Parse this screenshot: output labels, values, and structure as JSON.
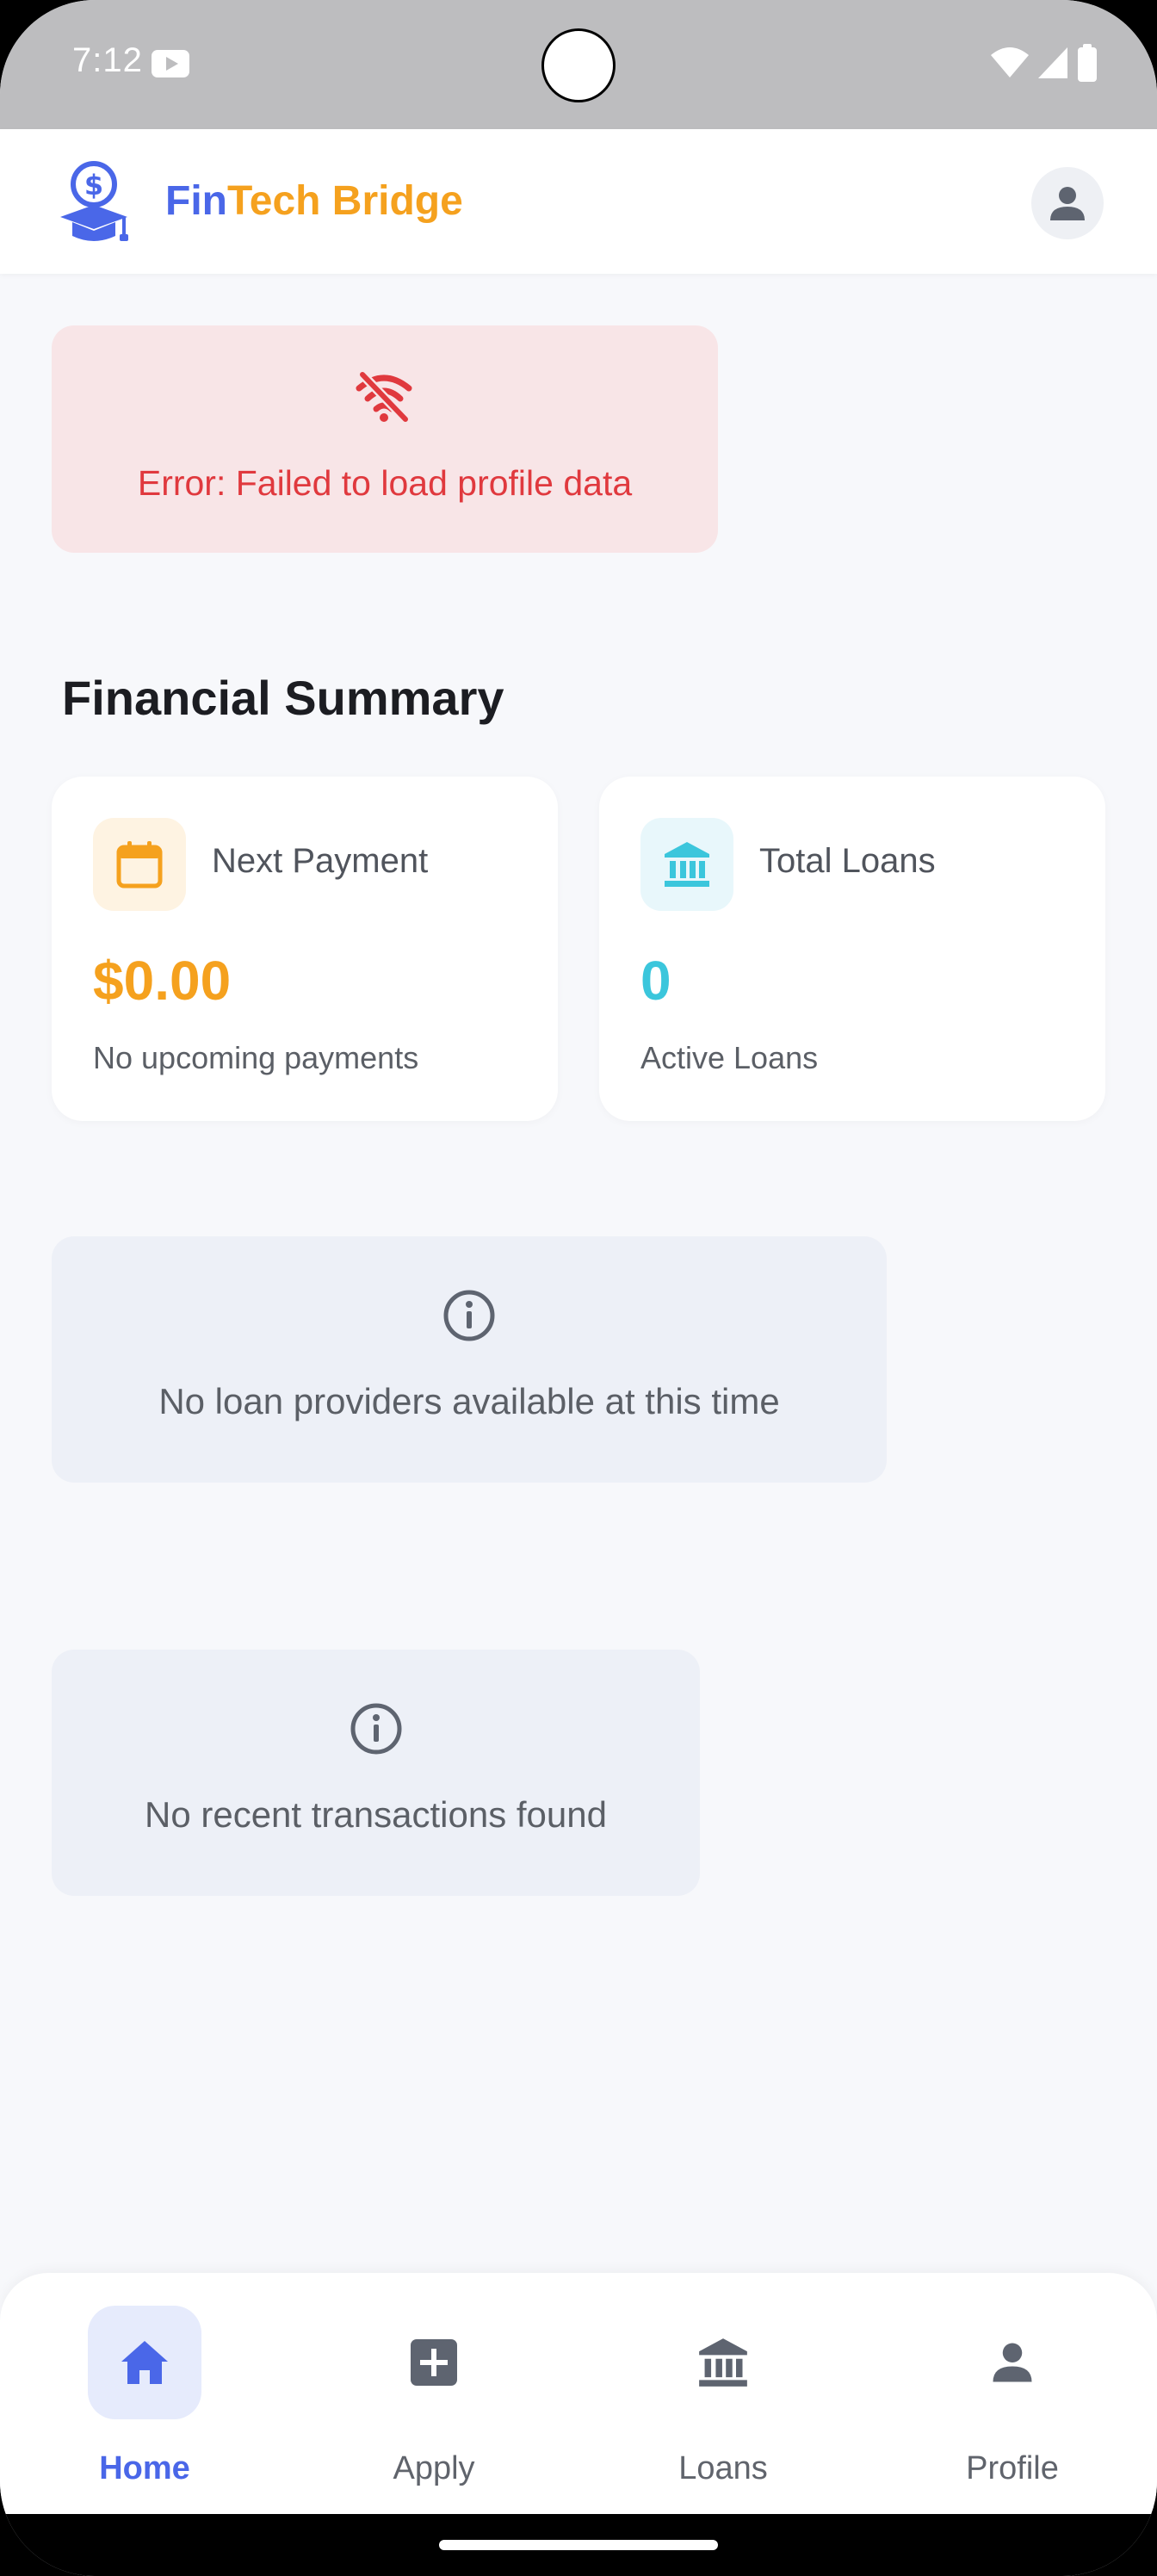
{
  "status_bar": {
    "time": "7:12",
    "notification_icon": "youtube-icon",
    "icons": [
      "wifi-icon",
      "cellular-signal-icon",
      "battery-icon"
    ]
  },
  "header": {
    "logo_icon": "graduation-cap-dollar-icon",
    "brand_part1": "Fin",
    "brand_part2": "Tech Bridge",
    "brand_colors": {
      "fin": "#4A67E8",
      "rest": "#F5A11E"
    },
    "avatar_icon": "user-icon"
  },
  "error": {
    "icon": "wifi-off-icon",
    "message": "Error: Failed to load profile data",
    "color": "#E0393E",
    "background": "#F8E5E7"
  },
  "financial_summary": {
    "title": "Financial Summary",
    "cards": [
      {
        "icon": "calendar-icon",
        "label": "Next Payment",
        "value": "$0.00",
        "subtitle": "No upcoming payments",
        "accent": "#F5A11E"
      },
      {
        "icon": "bank-icon",
        "label": "Total Loans",
        "value": "0",
        "subtitle": "Active Loans",
        "accent": "#3BC6DC"
      }
    ]
  },
  "providers": {
    "icon": "info-icon",
    "message": "No loan providers available at this time"
  },
  "transactions": {
    "icon": "info-icon",
    "message": "No recent transactions found"
  },
  "bottom_nav": {
    "active": "Home",
    "items": [
      {
        "label": "Home",
        "icon": "home-icon"
      },
      {
        "label": "Apply",
        "icon": "add-box-icon"
      },
      {
        "label": "Loans",
        "icon": "bank-icon"
      },
      {
        "label": "Profile",
        "icon": "user-icon"
      }
    ],
    "accent": "#4A67E8"
  }
}
